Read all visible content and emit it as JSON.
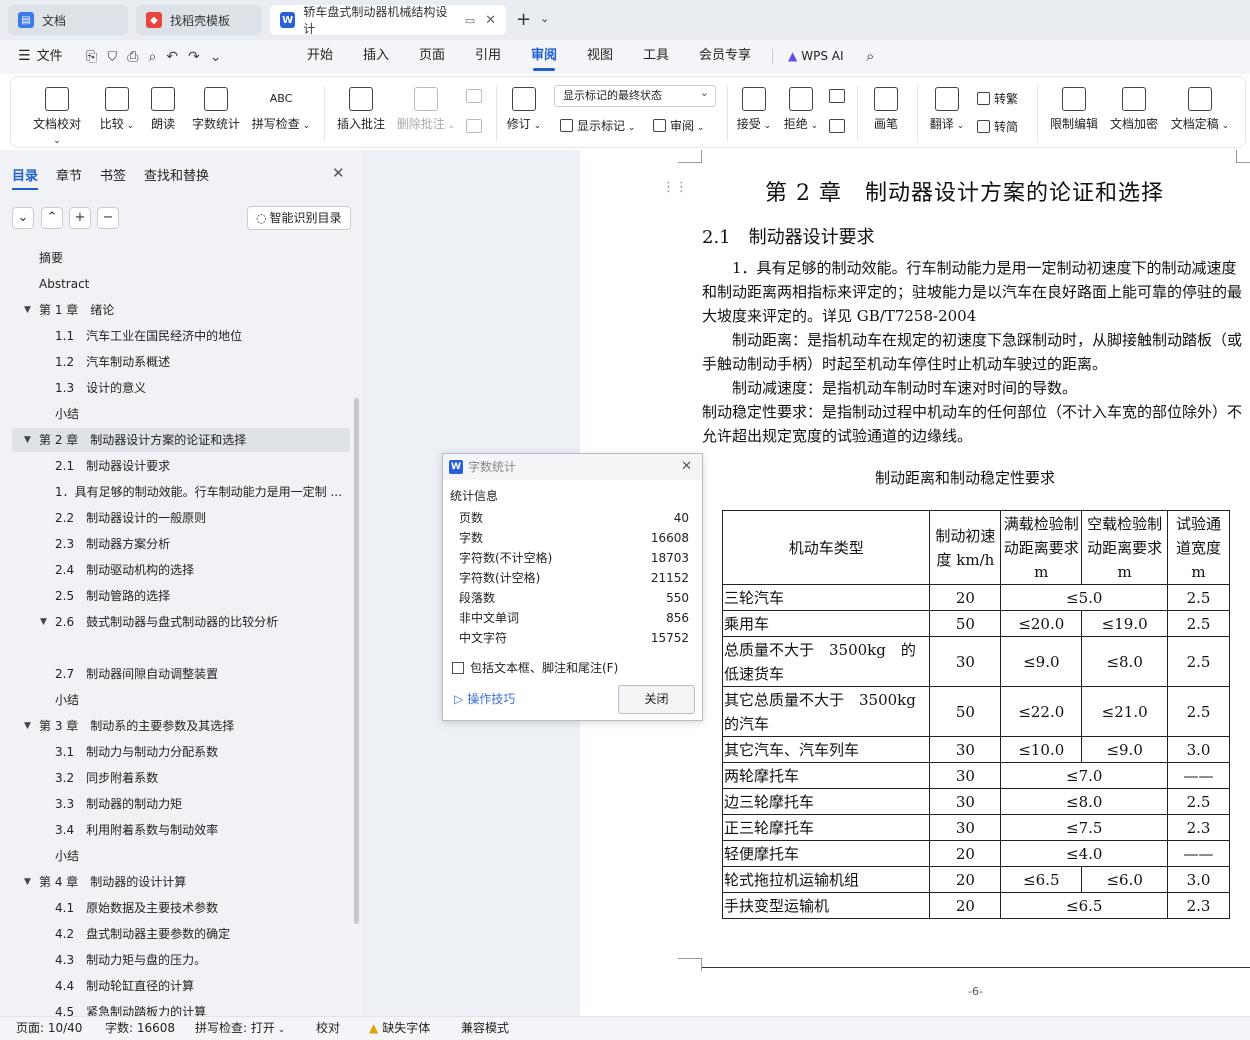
{
  "tabs": [
    {
      "label": "文档",
      "icon": "docs-icon",
      "color": "#3b7be8"
    },
    {
      "label": "找稻壳模板",
      "icon": "docer-icon",
      "color": "#e8453c"
    },
    {
      "label": "轿车盘式制动器机械结构设计",
      "icon": "wps-writer-icon",
      "color": "#2b5fd9"
    }
  ],
  "menu": {
    "file": "文件",
    "items": [
      "开始",
      "插入",
      "页面",
      "引用",
      "审阅",
      "视图",
      "工具",
      "会员专享"
    ],
    "active": "审阅",
    "wps_ai": "WPS AI"
  },
  "ribbon": {
    "doc_check": "文档校对",
    "compare": "比较",
    "read_aloud": "朗读",
    "word_count": "字数统计",
    "spell_check": "拼写检查",
    "insert_comment": "插入批注",
    "delete_comment": "删除批注",
    "revise": "修订",
    "markup_select": "显示标记的最终状态",
    "show_markup": "显示标记",
    "review": "审阅",
    "accept": "接受",
    "reject": "拒绝",
    "pen": "画笔",
    "translate": "翻译",
    "to_traditional": "转繁",
    "to_simplified": "转简",
    "restrict_edit": "限制编辑",
    "encrypt": "文档加密",
    "finalize": "文档定稿"
  },
  "panel": {
    "tabs": [
      "目录",
      "章节",
      "书签",
      "查找和替换"
    ],
    "active_tab": "目录",
    "smart_toc": "智能识别目录",
    "toc": [
      {
        "text": "摘要",
        "level": 0
      },
      {
        "text": "Abstract",
        "level": 0
      },
      {
        "text": "第 1 章　绪论",
        "level": 1,
        "expand": true
      },
      {
        "text": "1.1　汽车工业在国民经济中的地位",
        "level": 2
      },
      {
        "text": "1.2　汽车制动系概述",
        "level": 2
      },
      {
        "text": "1.3　设计的意义",
        "level": 2
      },
      {
        "text": "小结",
        "level": 2
      },
      {
        "text": "第 2 章　制动器设计方案的论证和选择",
        "level": 1,
        "expand": true,
        "selected": true
      },
      {
        "text": "2.1　制动器设计要求",
        "level": 2
      },
      {
        "text": "1．具有足够的制动效能。行车制动能力是用一定制 ...",
        "level": 2
      },
      {
        "text": "2.2　制动器设计的一般原则",
        "level": 2
      },
      {
        "text": "2.3　制动器方案分析",
        "level": 2
      },
      {
        "text": "2.4　制动驱动机构的选择",
        "level": 2
      },
      {
        "text": "2.5　制动管路的选择",
        "level": 2
      },
      {
        "text": "2.6　鼓式制动器与盘式制动器的比较分析",
        "level": 2,
        "expand": true
      },
      {
        "text": "",
        "level": 2
      },
      {
        "text": "2.7　制动器间隙自动调整装置",
        "level": 2
      },
      {
        "text": "小结",
        "level": 2
      },
      {
        "text": "第 3 章　制动系的主要参数及其选择",
        "level": 1,
        "expand": true
      },
      {
        "text": "3.1　制动力与制动力分配系数",
        "level": 2
      },
      {
        "text": "3.2　同步附着系数",
        "level": 2
      },
      {
        "text": "3.3　制动器的制动力矩",
        "level": 2
      },
      {
        "text": "3.4　利用附着系数与制动效率",
        "level": 2
      },
      {
        "text": "小结",
        "level": 2
      },
      {
        "text": "第 4 章　制动器的设计计算",
        "level": 1,
        "expand": true
      },
      {
        "text": "4.1　原始数据及主要技术参数",
        "level": 2
      },
      {
        "text": "4.2　盘式制动器主要参数的确定",
        "level": 2
      },
      {
        "text": "4.3　制动力矩与盘的压力。",
        "level": 2
      },
      {
        "text": "4.4　制动轮缸直径的计算",
        "level": 2
      },
      {
        "text": "4.5　紧急制动踏板力的计算",
        "level": 2
      }
    ]
  },
  "document": {
    "chapter_title": "第 2 章　制动器设计方案的论证和选择",
    "section_title": "2.1　制动器设计要求",
    "p1": "　　1．具有足够的制动效能。行车制动能力是用一定制动初速度下的制动减速度和制动距离两相指标来评定的；驻坡能力是以汽车在良好路面上能可靠的停驻的最大坡度来评定的。详见 GB/T7258-2004",
    "p2": "　　制动距离：是指机动车在规定的初速度下急踩制动时，从脚接触制动踏板（或手触动制动手柄）时起至机动车停住时止机动车驶过的距离。",
    "p3": "　　制动减速度：是指机动车制动时车速对时间的导数。",
    "p4": "制动稳定性要求：是指制动过程中机动车的任何部位（不计入车宽的部位除外）不允许超出规定宽度的试验通道的边缘线。",
    "table_caption": "制动距离和制动稳定性要求",
    "table": {
      "h_type": "机动车类型",
      "h_speed": "制动初速度 km/h",
      "h_full": "满载检验制动距离要求 m",
      "h_empty": "空载检验制动距离要求 m",
      "h_width": "试验通道宽度 m",
      "rows": [
        {
          "type": "三轮汽车",
          "speed": "20",
          "merged": "≤5.0",
          "width": "2.5"
        },
        {
          "type": "乘用车",
          "speed": "50",
          "full": "≤20.0",
          "empty": "≤19.0",
          "width": "2.5"
        },
        {
          "type": "总质量不大于　3500kg　的低速货车",
          "speed": "30",
          "full": "≤9.0",
          "empty": "≤8.0",
          "width": "2.5",
          "tall": true
        },
        {
          "type": "其它总质量不大于　3500kg　的汽车",
          "speed": "50",
          "full": "≤22.0",
          "empty": "≤21.0",
          "width": "2.5",
          "tall": true
        },
        {
          "type": "其它汽车、汽车列车",
          "speed": "30",
          "full": "≤10.0",
          "empty": "≤9.0",
          "width": "3.0"
        },
        {
          "type": "两轮摩托车",
          "speed": "30",
          "merged": "≤7.0",
          "width": "——"
        },
        {
          "type": "边三轮摩托车",
          "speed": "30",
          "merged": "≤8.0",
          "width": "2.5"
        },
        {
          "type": "正三轮摩托车",
          "speed": "30",
          "merged": "≤7.5",
          "width": "2.3"
        },
        {
          "type": "轻便摩托车",
          "speed": "20",
          "merged": "≤4.0",
          "width": "——"
        },
        {
          "type": "轮式拖拉机运输机组",
          "speed": "20",
          "full": "≤6.5",
          "empty": "≤6.0",
          "width": "3.0"
        },
        {
          "type": "手扶变型运输机",
          "speed": "20",
          "merged": "≤6.5",
          "width": "2.3"
        }
      ]
    },
    "page_number": "-6-"
  },
  "dialog": {
    "title": "字数统计",
    "section": "统计信息",
    "stats": [
      {
        "label": "页数",
        "value": "40"
      },
      {
        "label": "字数",
        "value": "16608"
      },
      {
        "label": "字符数(不计空格)",
        "value": "18703"
      },
      {
        "label": "字符数(计空格)",
        "value": "21152"
      },
      {
        "label": "段落数",
        "value": "550"
      },
      {
        "label": "非中文单词",
        "value": "856"
      },
      {
        "label": "中文字符",
        "value": "15752"
      }
    ],
    "checkbox": "包括文本框、脚注和尾注(F)",
    "tips": "操作技巧",
    "close": "关闭"
  },
  "status": {
    "page": "页面: 10/40",
    "words": "字数: 16608",
    "spell": "拼写检查: 打开",
    "proof": "校对",
    "missing_font": "缺失字体",
    "compat": "兼容模式"
  }
}
